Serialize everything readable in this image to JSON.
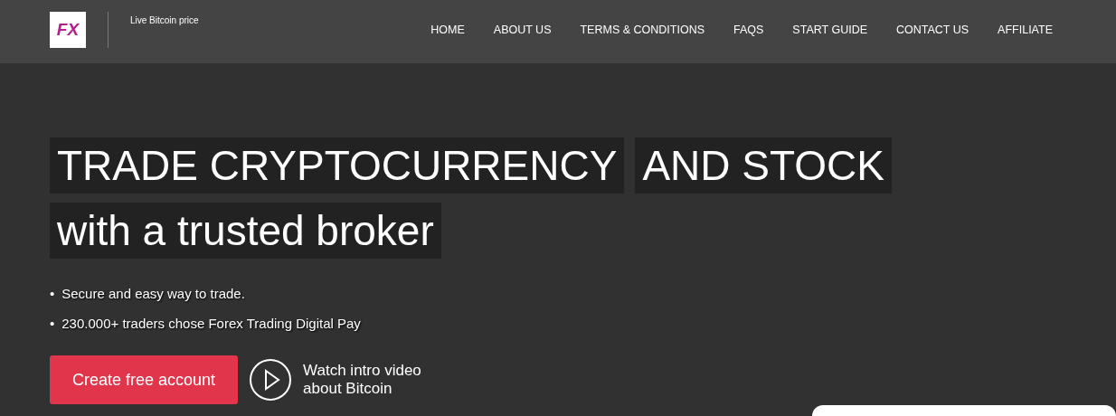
{
  "header": {
    "logo": "FX",
    "tagline": "Live Bitcoin price",
    "nav": [
      {
        "label": "HOME"
      },
      {
        "label": "ABOUT US"
      },
      {
        "label": "TERMS & CONDITIONS"
      },
      {
        "label": "FAQS"
      },
      {
        "label": "START GUIDE"
      },
      {
        "label": "CONTACT US"
      },
      {
        "label": "AFFILIATE"
      }
    ]
  },
  "hero": {
    "headline": [
      "TRADE CRYPTOCURRENCY",
      "AND STOCK",
      "with a trusted broker"
    ],
    "bullets": [
      {
        "marker": "•",
        "text": "Secure and easy way to trade."
      },
      {
        "marker": "•",
        "text": "230.000+ traders chose Forex Trading Digital Pay"
      }
    ],
    "cta": "Create free account",
    "video": "Watch intro video about Bitcoin"
  }
}
